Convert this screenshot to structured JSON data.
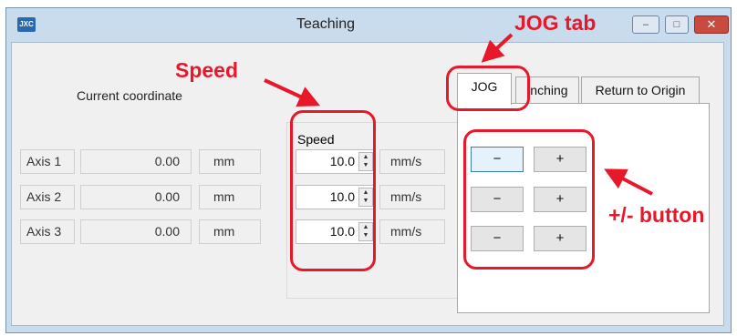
{
  "window": {
    "title": "Teaching",
    "app_icon_text": "JXC",
    "controls": {
      "minimize": "–",
      "maximize": "□",
      "close": "✕"
    }
  },
  "coordinates": {
    "header": "Current coordinate",
    "rows": [
      {
        "name": "Axis 1",
        "value": "0.00",
        "unit": "mm"
      },
      {
        "name": "Axis 2",
        "value": "0.00",
        "unit": "mm"
      },
      {
        "name": "Axis 3",
        "value": "0.00",
        "unit": "mm"
      }
    ]
  },
  "speed": {
    "header": "Speed",
    "rows": [
      {
        "value": "10.0",
        "unit": "mm/s"
      },
      {
        "value": "10.0",
        "unit": "mm/s"
      },
      {
        "value": "10.0",
        "unit": "mm/s"
      }
    ]
  },
  "tabs": [
    {
      "label": "JOG",
      "selected": true
    },
    {
      "label": "Inching",
      "selected": false
    },
    {
      "label": "Return to Origin",
      "selected": false
    }
  ],
  "jog_buttons": {
    "minus": "−",
    "plus": "+"
  },
  "annotations": {
    "speed": "Speed",
    "jog_tab": "JOG tab",
    "plus_minus": "+/- button",
    "color": "#e8182b"
  }
}
